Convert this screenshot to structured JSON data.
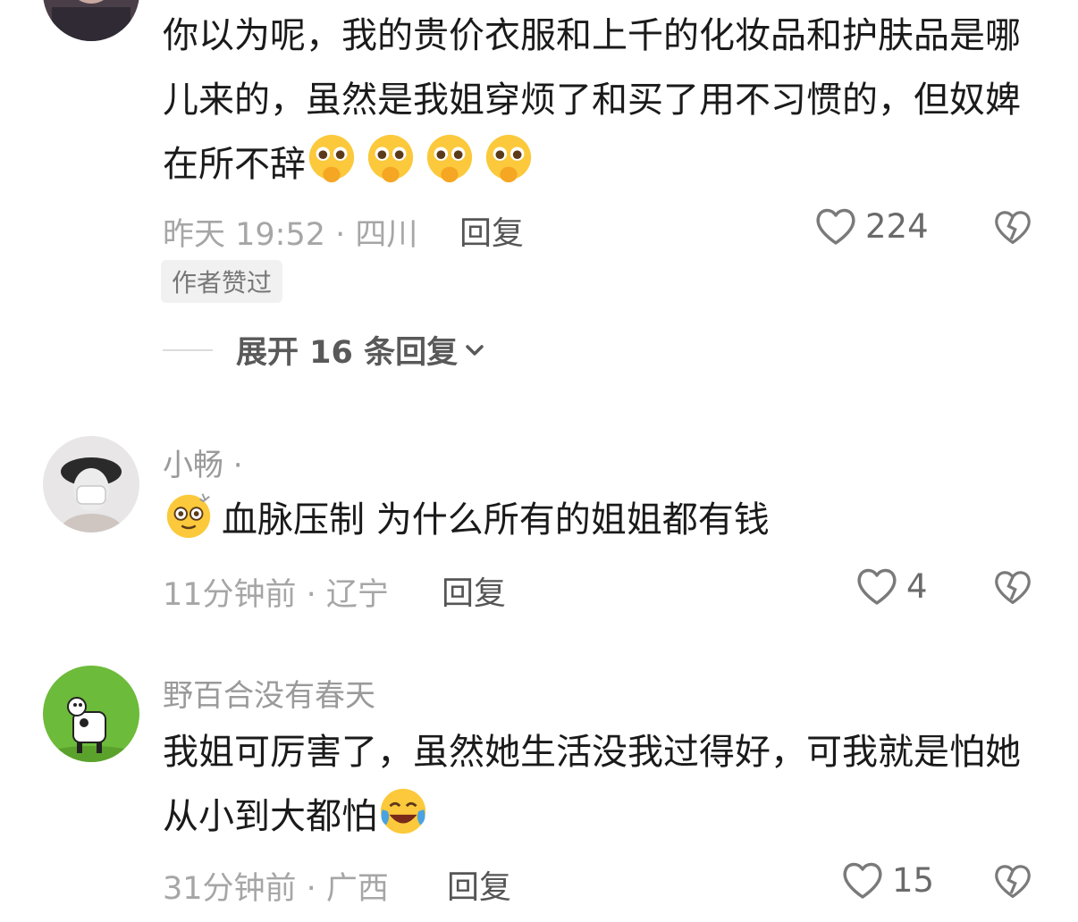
{
  "comments": [
    {
      "username": "",
      "text": "你以为呢，我的贵价衣服和上千的化妆品和护肤品是哪儿来的，虽然是我姐穿烦了和买了用不习惯的，但奴婢在所不辞",
      "emoji": [
        "pleading-hands-emoji",
        "pleading-hands-emoji",
        "pleading-hands-emoji",
        "pleading-hands-emoji"
      ],
      "time_location": "昨天 19:52 · 四川",
      "reply_label": "回复",
      "likes": "224",
      "badge": "作者赞过",
      "expand_label": "展开 16 条回复"
    },
    {
      "username": "小畅 ·",
      "text": "血脉压制 为什么所有的姐姐都有钱",
      "emoji": [
        "dizzy-face-emoji"
      ],
      "time_location": "11分钟前 · 辽宁",
      "reply_label": "回复",
      "likes": "4"
    },
    {
      "username": "野百合没有春天",
      "text": "我姐可厉害了，虽然她生活没我过得好，可我就是怕她从小到大都怕",
      "emoji": [
        "crying-laughing-emoji"
      ],
      "time_location": "31分钟前 · 广西",
      "reply_label": "回复",
      "likes": "15"
    }
  ],
  "colors": {
    "text": "#1a1a1a",
    "meta": "#a6a6a6",
    "username": "#9a9a9a",
    "icon": "#7a7a7a"
  }
}
